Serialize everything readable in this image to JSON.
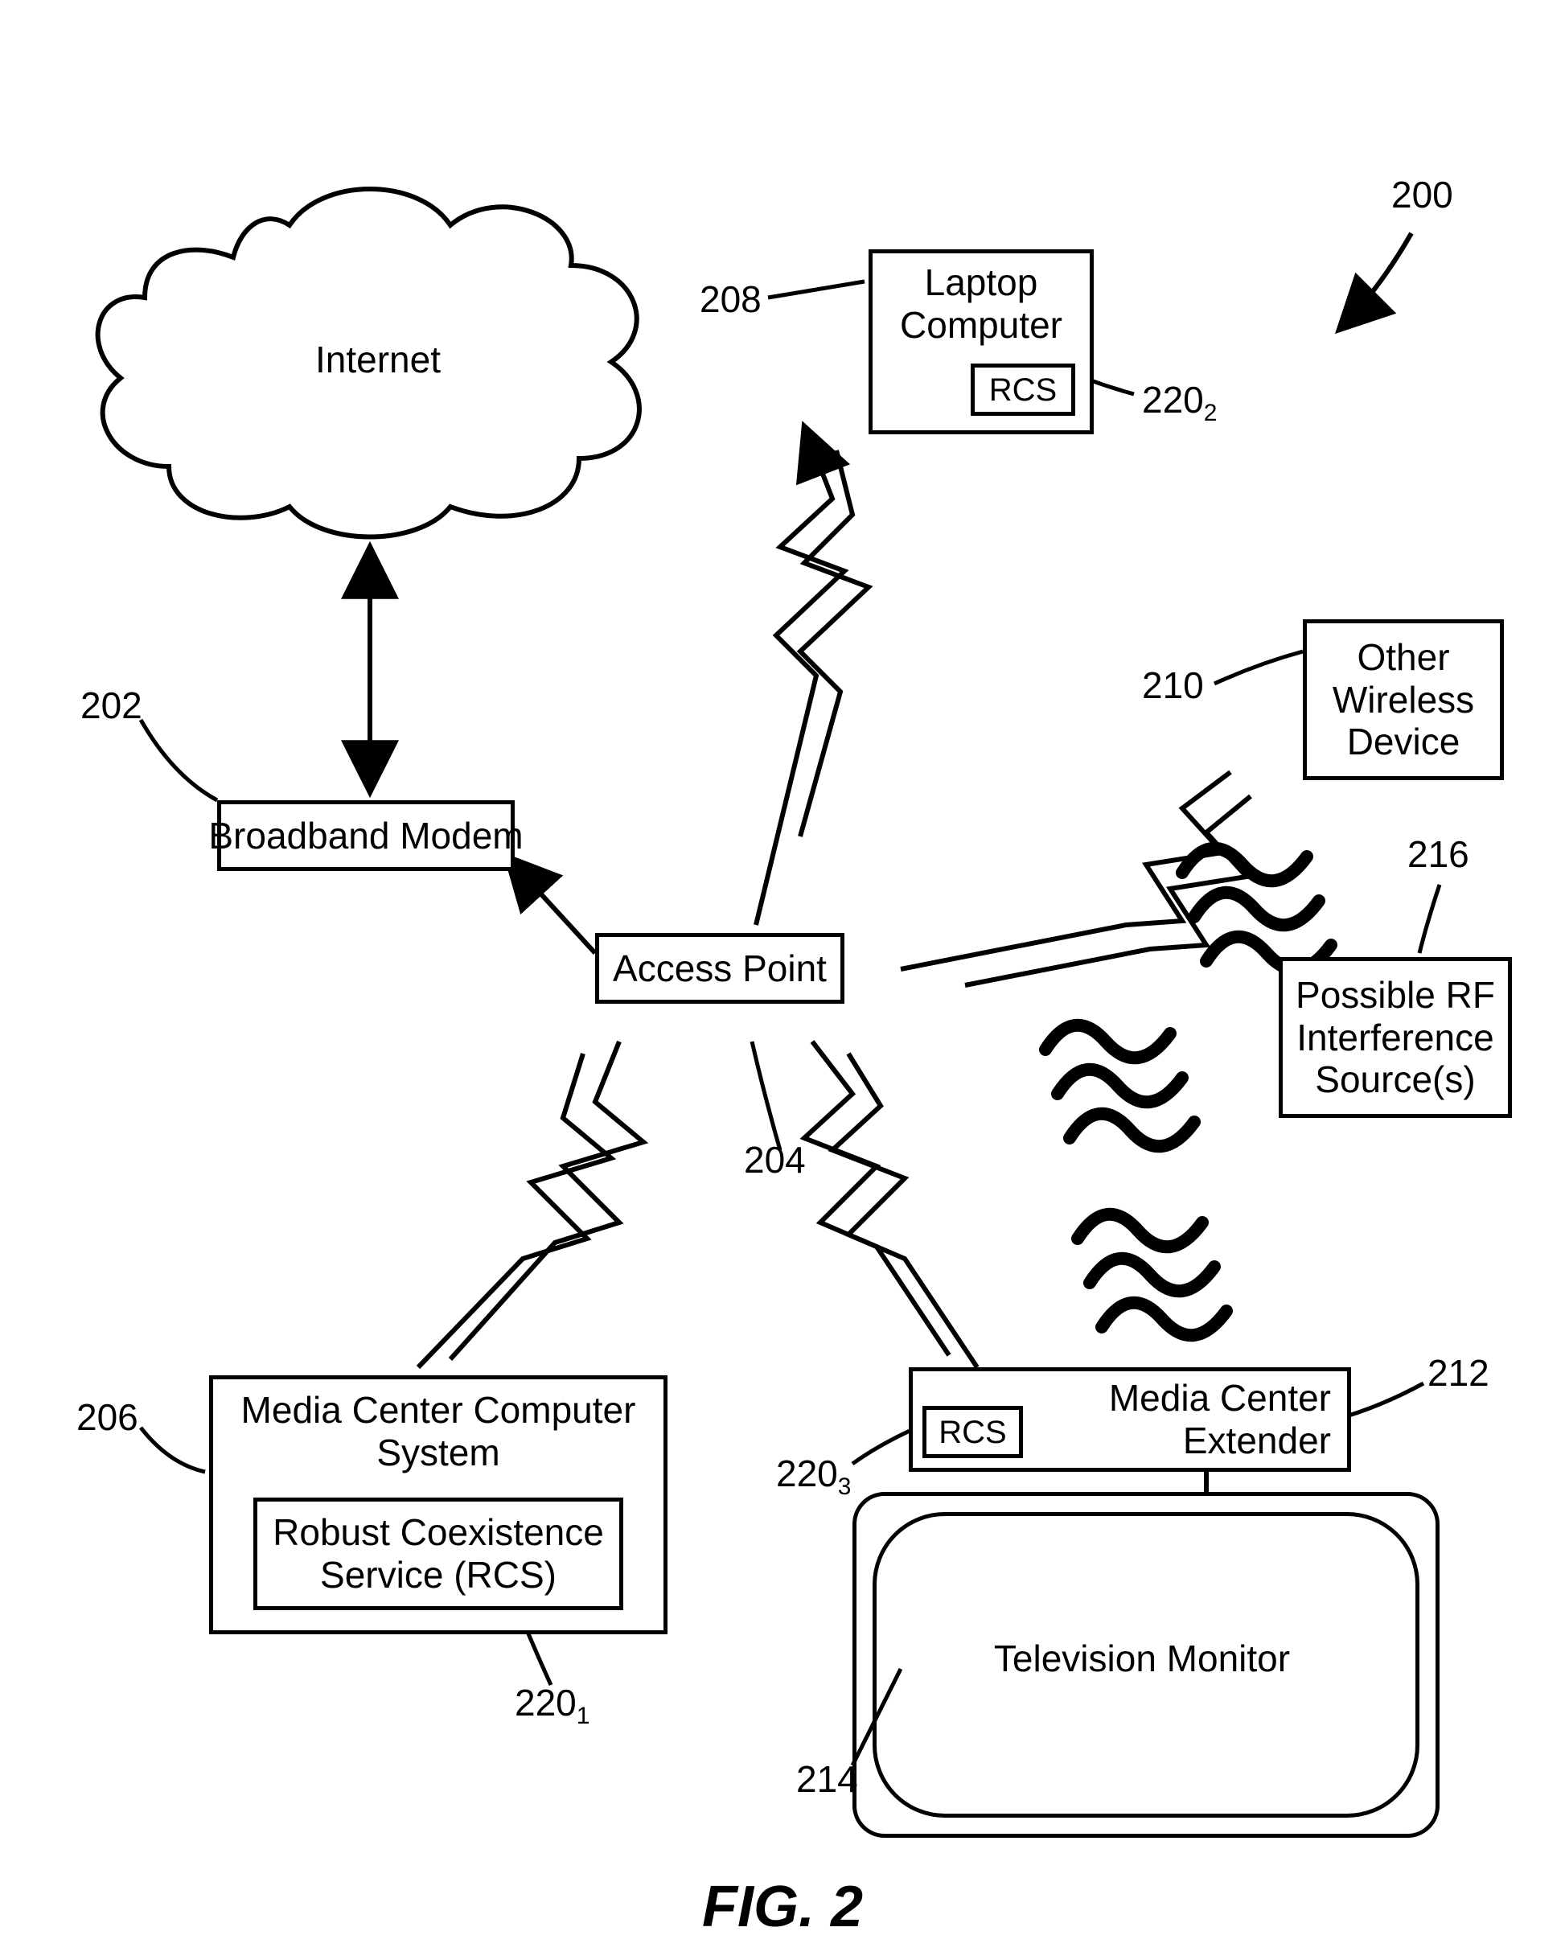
{
  "figure_caption": "FIG. 2",
  "refs": {
    "r200": "200",
    "r202": "202",
    "r204": "204",
    "r206": "206",
    "r208": "208",
    "r210": "210",
    "r212": "212",
    "r214": "214",
    "r216": "216",
    "r2201": "220",
    "r2201_sub": "1",
    "r2202": "220",
    "r2202_sub": "2",
    "r2203": "220",
    "r2203_sub": "3"
  },
  "nodes": {
    "internet": "Internet",
    "broadband_modem": "Broadband Modem",
    "access_point": "Access Point",
    "laptop_line1": "Laptop",
    "laptop_line2": "Computer",
    "laptop_rcs": "RCS",
    "other_line1": "Other",
    "other_line2": "Wireless",
    "other_line3": "Device",
    "rf_line1": "Possible RF",
    "rf_line2": "Interference",
    "rf_line3": "Source(s)",
    "media_center_line1": "Media Center Computer",
    "media_center_line2": "System",
    "rcs_full_line1": "Robust Coexistence",
    "rcs_full_line2": "Service (RCS)",
    "extender_line1": "Media Center",
    "extender_line2": "Extender",
    "extender_rcs": "RCS",
    "tv": "Television Monitor"
  }
}
